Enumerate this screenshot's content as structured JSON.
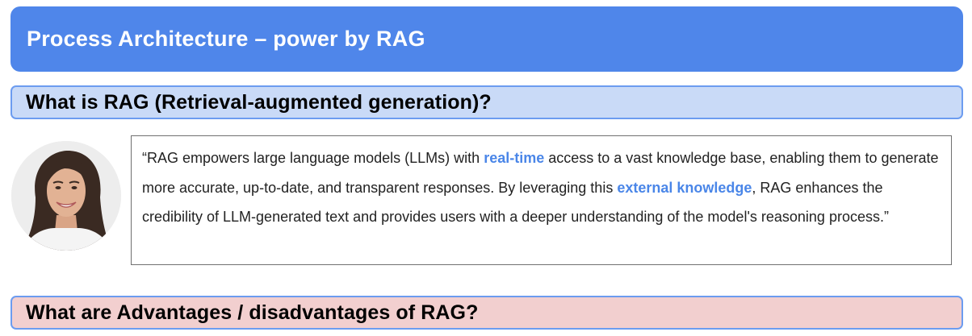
{
  "title": "Process Architecture – power by RAG",
  "section_what": "What is RAG (Retrieval-augmented generation)?",
  "section_adv": "What are Advantages / disadvantages of RAG?",
  "quote": {
    "part1": "“RAG empowers large language models (LLMs) with ",
    "highlight1": "real-time",
    "part2": " access to a vast knowledge base, enabling them to generate more accurate, up-to-date, and transparent responses. By leveraging this ",
    "highlight2": "external knowledge",
    "part3": ", RAG enhances the credibility of LLM-generated text and provides users with a deeper understanding of the model's reasoning process.”"
  },
  "colors": {
    "title_bg": "#4f86ea",
    "section_what_bg": "#c9daf7",
    "section_adv_bg": "#f2cfcf",
    "section_border": "#6c9cf0",
    "highlight": "#4a86e8"
  },
  "avatar": {
    "icon": "person-portrait-icon"
  }
}
